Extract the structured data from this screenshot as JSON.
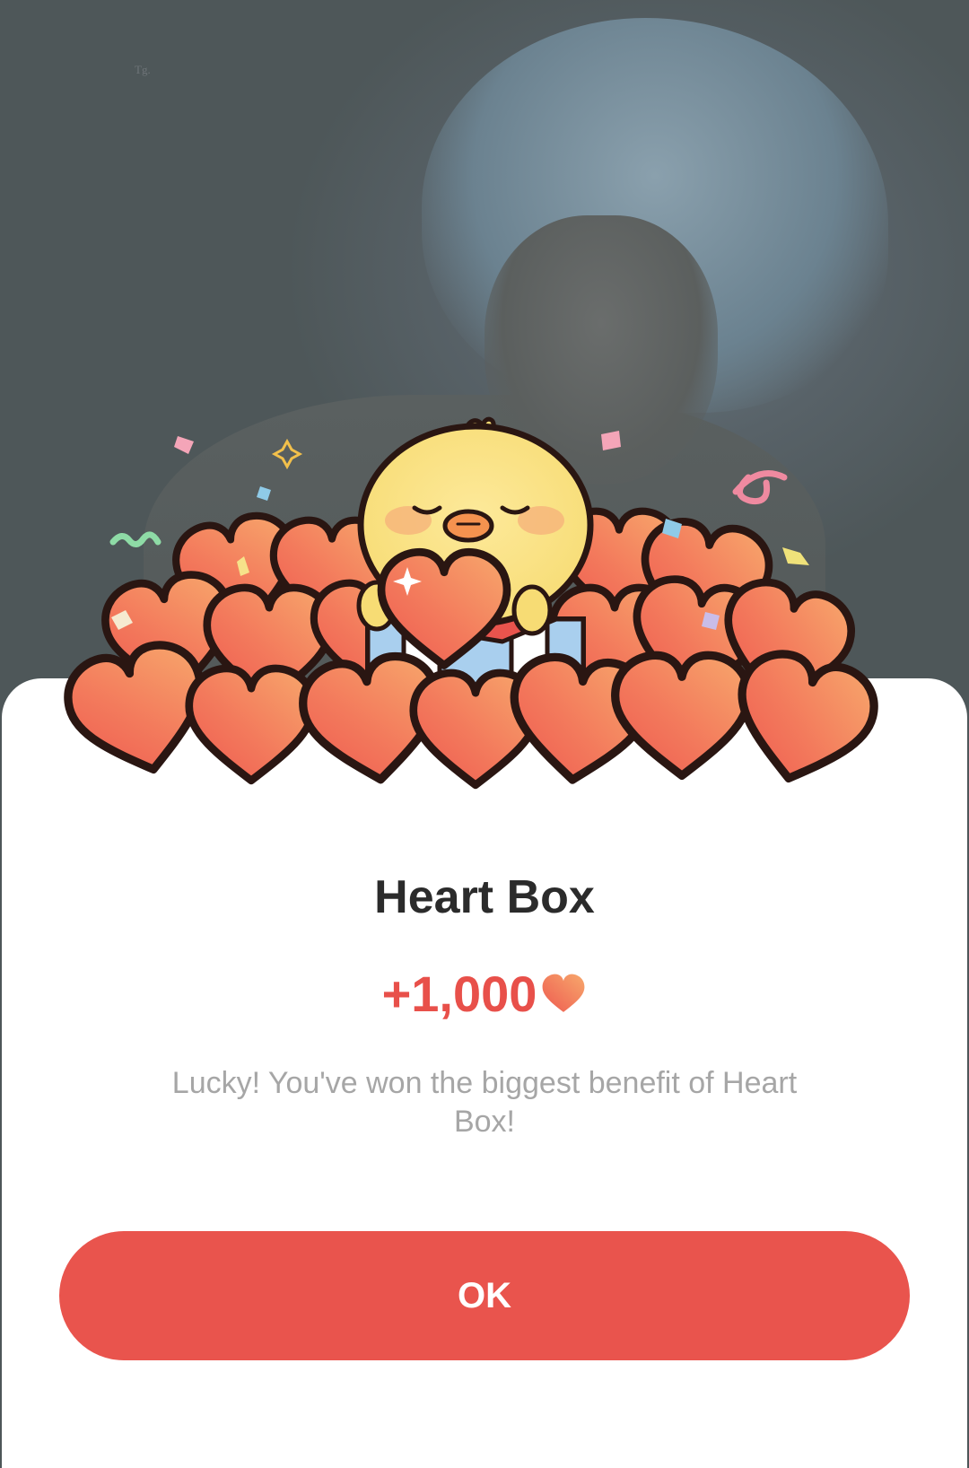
{
  "background": {
    "watermark": "Tg."
  },
  "dialog": {
    "title": "Heart Box",
    "amount": "+1,000",
    "message": "Lucky! You've won the biggest benefit of Heart Box!",
    "ok_label": "OK"
  },
  "colors": {
    "accent": "#e9544d",
    "amount_text": "#e8504a",
    "title_text": "#2b2b2b",
    "message_text": "#a6a6a6",
    "heart_light": "#f6a06a",
    "heart_dark": "#ef5d52"
  },
  "icons": [
    "heart-icon",
    "chick-mascot",
    "gift-box",
    "confetti"
  ]
}
